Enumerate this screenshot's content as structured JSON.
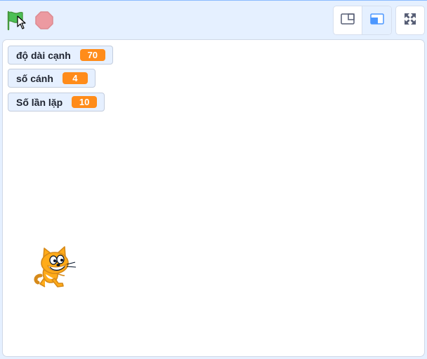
{
  "toolbar": {
    "green_flag_icon": "green-flag-icon",
    "stop_icon": "stop-sign-icon",
    "small_stage_icon": "small-stage-icon",
    "large_stage_icon": "large-stage-icon",
    "fullscreen_icon": "fullscreen-icon"
  },
  "monitors": [
    {
      "label": "độ dài cạnh",
      "value": "70"
    },
    {
      "label": "số cánh",
      "value": "4"
    },
    {
      "label": "Số lần lặp",
      "value": "10"
    }
  ],
  "stage": {
    "sprite": "scratch-cat"
  },
  "colors": {
    "accent": "#4c97ff",
    "monitor_value": "#ff8c1a",
    "flag": "#4cbf56",
    "stop": "#ec5959"
  }
}
